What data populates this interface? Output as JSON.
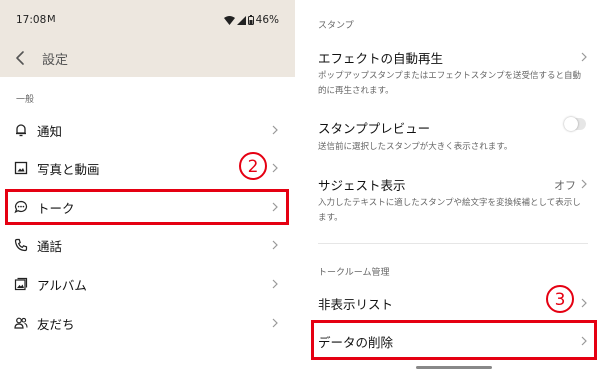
{
  "status_bar": {
    "time": "17:08",
    "mail_glyph": "M",
    "battery": "46%"
  },
  "header": {
    "title": "設定"
  },
  "left_section": {
    "label": "一般"
  },
  "menu_items": [
    {
      "label": "通知",
      "icon": "bell-icon"
    },
    {
      "label": "写真と動画",
      "icon": "photo-icon"
    },
    {
      "label": "トーク",
      "icon": "chat-icon"
    },
    {
      "label": "通話",
      "icon": "phone-icon"
    },
    {
      "label": "アルバム",
      "icon": "album-icon"
    },
    {
      "label": "友だち",
      "icon": "friends-icon"
    }
  ],
  "annotations": {
    "step2": "②",
    "step3": "③",
    "color": "#e50012"
  },
  "right": {
    "stamp_section": "スタンプ",
    "effect_autoplay": {
      "title": "エフェクトの自動再生",
      "desc": "ポップアップスタンプまたはエフェクトスタンプを送受信すると自動的に再生されます。"
    },
    "stamp_preview": {
      "title": "スタンププレビュー",
      "desc": "送信前に選択したスタンプが大きく表示されます。",
      "toggle_on": false
    },
    "suggest": {
      "title": "サジェスト表示",
      "value": "オフ",
      "desc": "入力したテキストに適したスタンプや絵文字を変換候補として表示します。"
    },
    "talkroom_section": "トークルーム管理",
    "hidden_list": {
      "title": "非表示リスト"
    },
    "delete_data": {
      "title": "データの削除"
    }
  }
}
